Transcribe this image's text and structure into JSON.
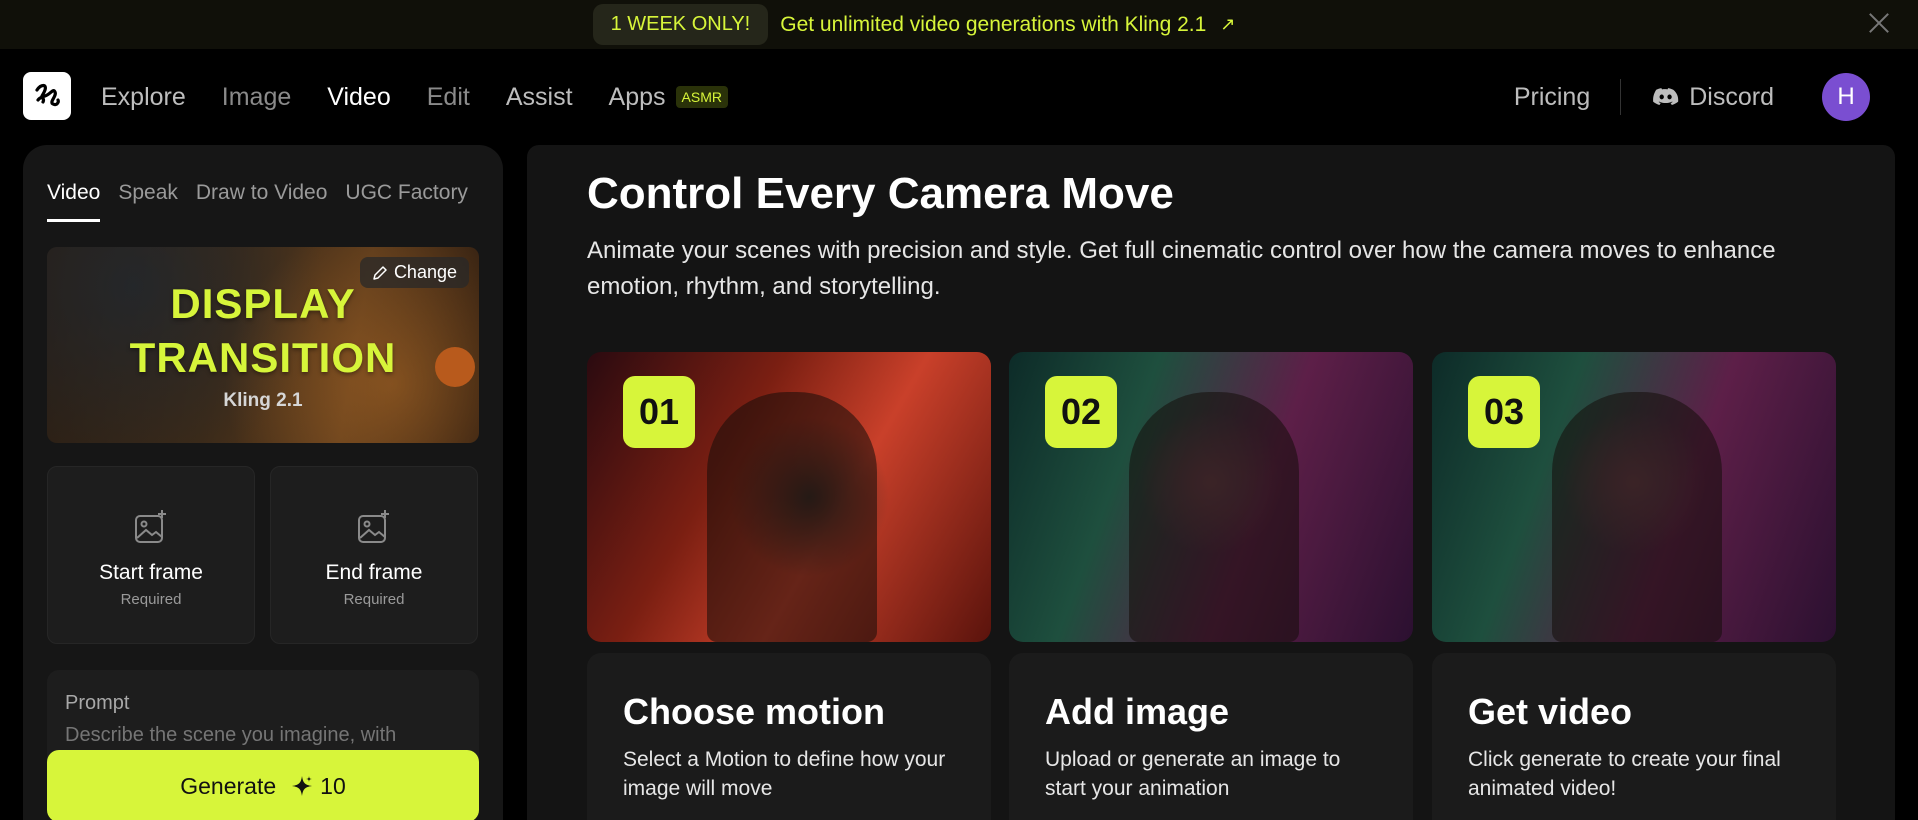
{
  "banner": {
    "badge": "1 WEEK ONLY!",
    "text": "Get unlimited video generations with Kling 2.1",
    "arrow": "↗"
  },
  "nav": {
    "links": [
      "Explore",
      "Image",
      "Video",
      "Edit",
      "Assist",
      "Apps"
    ],
    "apps_badge": "ASMR",
    "pricing": "Pricing",
    "discord": "Discord",
    "avatar_initial": "H"
  },
  "left_panel": {
    "tabs": [
      "Video",
      "Speak",
      "Draw to Video",
      "UGC Factory"
    ],
    "preview": {
      "title_line1": "DISPLAY",
      "title_line2": "TRANSITION",
      "subtitle": "Kling 2.1",
      "change_label": "Change"
    },
    "start_frame": {
      "label": "Start frame",
      "required": "Required"
    },
    "end_frame": {
      "label": "End frame",
      "required": "Required"
    },
    "prompt": {
      "label": "Prompt",
      "placeholder": "Describe the scene you imagine, with"
    },
    "generate": {
      "label": "Generate",
      "cost": "10"
    }
  },
  "main": {
    "headline": "Control Every Camera Move",
    "description": "Animate your scenes with precision and style. Get full cinematic control over how the camera moves to enhance emotion, rhythm, and storytelling.",
    "steps": [
      {
        "number": "01",
        "title": "Choose motion",
        "text": "Select a Motion to define how your image will move"
      },
      {
        "number": "02",
        "title": "Add image",
        "text": "Upload or generate an image to start your animation"
      },
      {
        "number": "03",
        "title": "Get video",
        "text": "Click generate to create your final animated video!"
      }
    ]
  },
  "colors": {
    "accent": "#d7f53a",
    "avatar": "#7a4ed1"
  }
}
